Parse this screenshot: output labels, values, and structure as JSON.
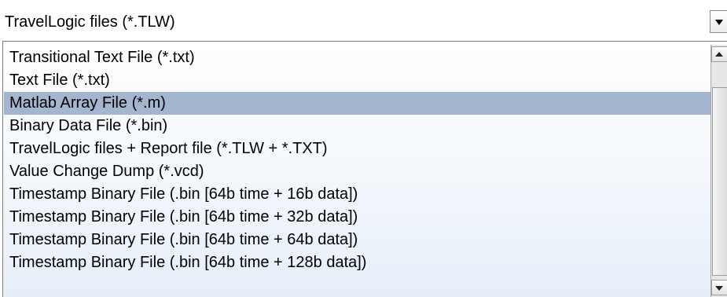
{
  "combo": {
    "selected_value": "TravelLogic files (*.TLW)"
  },
  "list": {
    "items": [
      {
        "label": "Transitional Text File (*.txt)",
        "selected": false
      },
      {
        "label": "Text File (*.txt)",
        "selected": false
      },
      {
        "label": "Matlab Array File (*.m)",
        "selected": true
      },
      {
        "label": "Binary Data File (*.bin)",
        "selected": false
      },
      {
        "label": "TravelLogic files + Report file (*.TLW + *.TXT)",
        "selected": false
      },
      {
        "label": "Value Change Dump (*.vcd)",
        "selected": false
      },
      {
        "label": "Timestamp Binary File (.bin [64b time + 16b data])",
        "selected": false
      },
      {
        "label": "Timestamp Binary File (.bin [64b time + 32b data])",
        "selected": false
      },
      {
        "label": "Timestamp Binary File (.bin [64b time + 64b data])",
        "selected": false
      },
      {
        "label": "Timestamp Binary File (.bin [64b time + 128b data])",
        "selected": false
      }
    ]
  },
  "icons": {
    "dropdown": "chevron-down-icon",
    "scroll_up": "arrow-up-icon",
    "scroll_down": "arrow-down-icon"
  },
  "colors": {
    "selection_highlight": "#a4b5cf"
  }
}
